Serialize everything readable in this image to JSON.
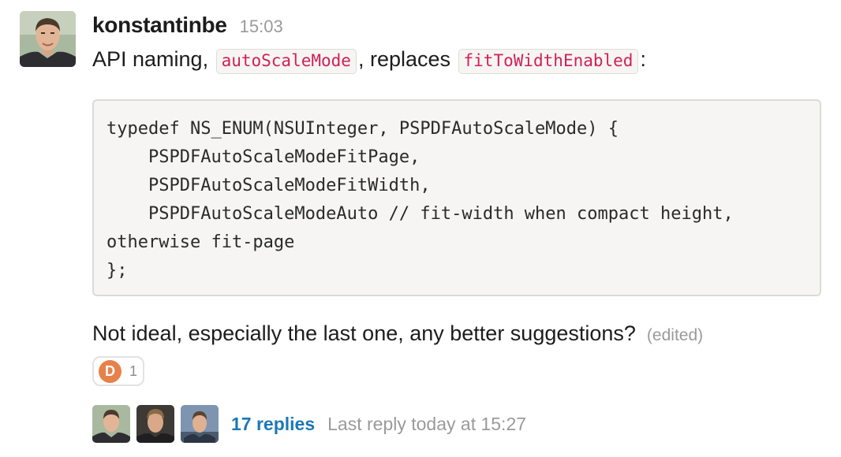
{
  "message": {
    "author": "konstantinbe",
    "timestamp": "15:03",
    "line1": {
      "prefix": "API naming, ",
      "code1": "autoScaleMode",
      "middle": ", replaces ",
      "code2": "fitToWidthEnabled",
      "suffix": ":"
    },
    "code_block": [
      "typedef NS_ENUM(NSUInteger, PSPDFAutoScaleMode) {",
      "    PSPDFAutoScaleModeFitPage,",
      "    PSPDFAutoScaleModeFitWidth,",
      "    PSPDFAutoScaleModeAuto // fit-width when compact height,",
      "otherwise fit-page",
      "};"
    ],
    "line2": "Not ideal, especially the last one, any better suggestions?",
    "edited_label": "(edited)"
  },
  "reaction": {
    "letter": "D",
    "count": "1",
    "color": "#e7814a"
  },
  "thread": {
    "replies_label": "17 replies",
    "last_reply": "Last reply today at 15:27",
    "link_color": "#1d78b4"
  },
  "icons": [
    "user-avatar-icon",
    "reaction-d-icon"
  ]
}
